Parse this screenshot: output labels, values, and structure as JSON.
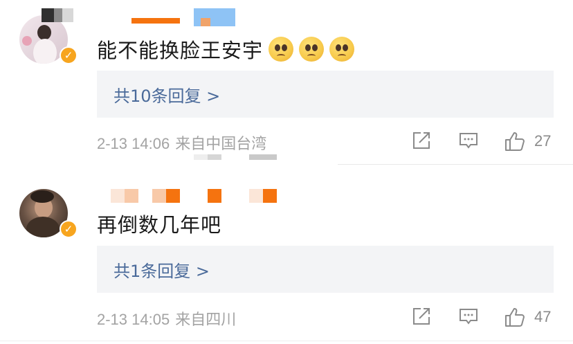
{
  "comments": [
    {
      "text": "能不能换脸王安宇",
      "emoji": [
        "pleading-face-emoji",
        "pleading-face-emoji",
        "pleading-face-emoji"
      ],
      "replies_label": "共10条回复 >",
      "time": "2-13 14:06",
      "location": "来自中国台湾",
      "likes": "27"
    },
    {
      "text": "再倒数几年吧",
      "replies_label": "共1条回复 >",
      "time": "2-13 14:05",
      "location": "来自四川",
      "likes": "47"
    }
  ],
  "colors": {
    "accent_link": "#4a6a9a",
    "verified_badge": "#f7a51f",
    "reply_bg": "#f3f4f6",
    "muted_text": "#a3a3a3",
    "redaction_orange": "#f5730f"
  },
  "icons": {
    "share": "share-icon",
    "comment": "comment-icon",
    "like": "thumbs-up-icon",
    "verified": "verified-badge-icon"
  }
}
